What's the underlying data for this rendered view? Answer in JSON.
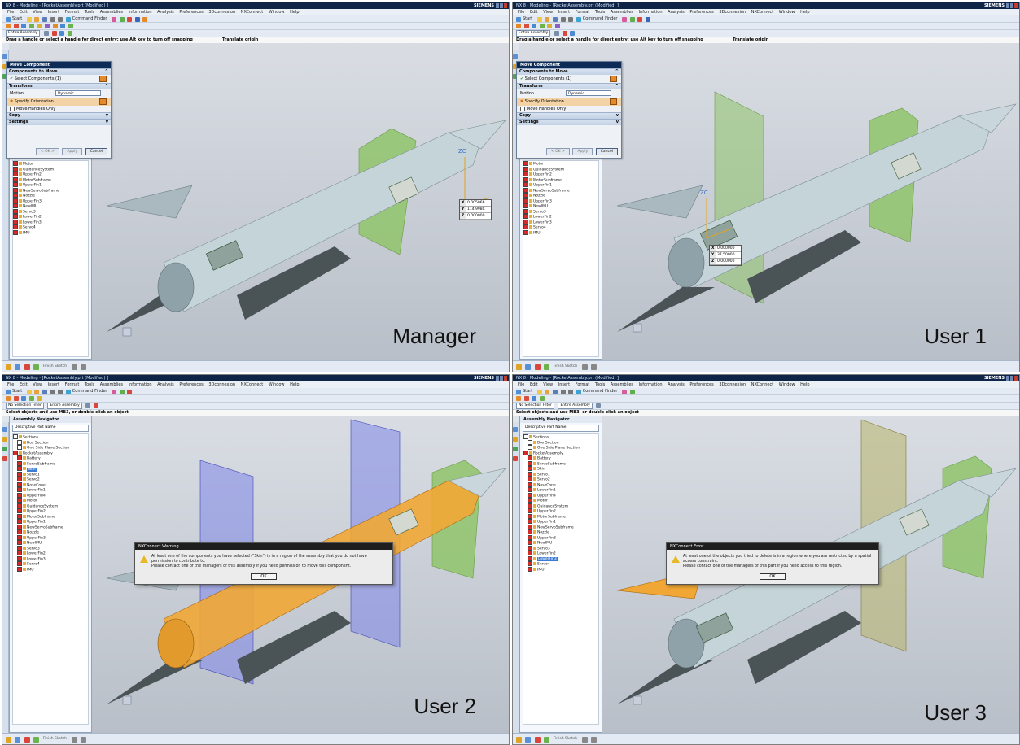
{
  "app": {
    "title_p1": "NX 8 - Modeling - [RocketAssembly.prt (Modified) ]",
    "brand": "SIEMENS",
    "menu": [
      "File",
      "Edit",
      "View",
      "Insert",
      "Format",
      "Tools",
      "Assemblies",
      "Information",
      "Analysis",
      "Preferences",
      "3Dconnexion",
      "NXConnect",
      "Window",
      "Help"
    ],
    "toolbar": {
      "start_label": "Start",
      "command_finder": "Command Finder",
      "entire_assembly": "Entire Assembly",
      "no_selection_filter": "No Selection Filter",
      "finish_sketch": "Finish Sketch"
    }
  },
  "panes": [
    {
      "id": "manager",
      "role_label": "Manager",
      "cue": "Drag a handle or select a handle for direct entry; use Alt key to turn off snapping",
      "status": "Translate origin",
      "coords": {
        "x": "0.005066",
        "y": "114.998C",
        "z": "0.000000"
      }
    },
    {
      "id": "user1",
      "role_label": "User 1",
      "cue": "Drag a handle or select a handle for direct entry; use Alt key to turn off snapping",
      "status": "Translate origin",
      "coords": {
        "x": "0.000000",
        "y": "37.50000",
        "z": "0.000000"
      }
    },
    {
      "id": "user2",
      "role_label": "User 2",
      "cue": "Select objects and use MB3, or double-click an object",
      "status": "",
      "popup": {
        "title": "NXConnect Warning",
        "message_1": "At least one of the components you have selected (\"Skin\") is in a region of the assembly that you do not have permission to contribute to.",
        "message_2": "Please contact one of the managers of this assembly if you need permission to move this component.",
        "ok": "OK"
      }
    },
    {
      "id": "user3",
      "role_label": "User 3",
      "cue": "Select objects and use MB3, or double-click an object",
      "status": "",
      "popup": {
        "title": "NXConnect Error",
        "message_1": "At least one of the objects you tried to delete is in a region where you are restricted by a spatial access constraint.",
        "message_2": "Please contact one of the managers of this part if you need access to this region.",
        "ok": "OK"
      }
    }
  ],
  "dialog": {
    "title": "Move Component",
    "components_to_move": "Components to Move",
    "select_components": "Select Components (1)",
    "transform": "Transform",
    "motion_label": "Motion",
    "motion_value": "Dynamic",
    "specify_orientation": "Specify Orientation",
    "move_handles_only": "Move Handles Only",
    "copy": "Copy",
    "settings": "Settings",
    "ok": "< OK >",
    "apply": "Apply",
    "cancel": "Cancel"
  },
  "navigator": {
    "title": "Assembly Navigator",
    "column": "Descriptive Part Name",
    "full_list": [
      "Sections",
      "Box Section",
      "One Side Plane Section",
      "RocketAssembly",
      "Battery",
      "ServoSubframe",
      "Skin",
      "Servo1",
      "Servo2",
      "NoseCone",
      "LowerFin1",
      "UpperFin4",
      "Motor",
      "GuidanceSystem",
      "UpperFin2",
      "MotorSubframe",
      "UpperFin1",
      "NewServoSubframe",
      "Nozzle",
      "UpperFin3",
      "NewIMU",
      "Servo3",
      "LowerFin2",
      "LowerFin3",
      "Servo4",
      "IMU"
    ],
    "partial_list": [
      "Motor",
      "GuidanceSystem",
      "UpperFin2",
      "MotorSubframe",
      "UpperFin1",
      "NewServoSubframe",
      "Nozzle",
      "UpperFin3",
      "NewIMU",
      "Servo3",
      "LowerFin2",
      "LowerFin3",
      "Servo4",
      "IMU"
    ],
    "selected_user2": "Skin",
    "selected_user3": "LowerFin3"
  },
  "colors": {
    "plane_green": "#8fc46a",
    "plane_blue": "#7f86e8",
    "plane_olive": "#b8b46a",
    "highlight_orange": "#f1a735",
    "rocket_body": "#c4d4d8"
  }
}
